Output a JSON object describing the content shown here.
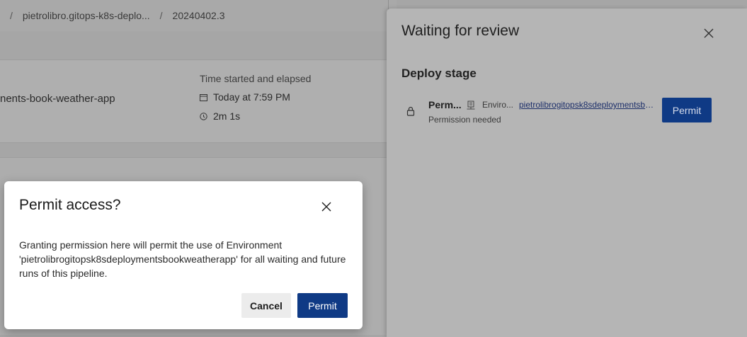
{
  "breadcrumb": {
    "items": [
      "pietrolibro.gitops-k8s-deplo...",
      "20240402.3"
    ],
    "separator": "/"
  },
  "summary": {
    "environment_fragment": "nents-book-weather-app",
    "time_label": "Time started and elapsed",
    "started": "Today at 7:59 PM",
    "elapsed": "2m 1s",
    "icons": [
      "calendar-icon",
      "clock-icon"
    ]
  },
  "review_panel": {
    "title": "Waiting for review",
    "stage_title": "Deploy stage",
    "check": {
      "name": "Perm...",
      "type": "Enviro...",
      "link": "pietrolibrogitopsk8sdeploymentsbookweatherapp",
      "status": "Permission needed",
      "permit_label": "Permit",
      "icons": [
        "lock-icon",
        "environment-icon"
      ]
    }
  },
  "dialog": {
    "title": "Permit access?",
    "body": "Granting permission here will permit the use of Environment 'pietrolibrogitopsk8sdeploymentsbookweatherapp' for all waiting and future runs of this pipeline.",
    "cancel_label": "Cancel",
    "permit_label": "Permit"
  },
  "colors": {
    "primary_button": "#0f3a85",
    "overlay_dim": "#a6a6a6",
    "dialog_bg": "#ffffff"
  }
}
